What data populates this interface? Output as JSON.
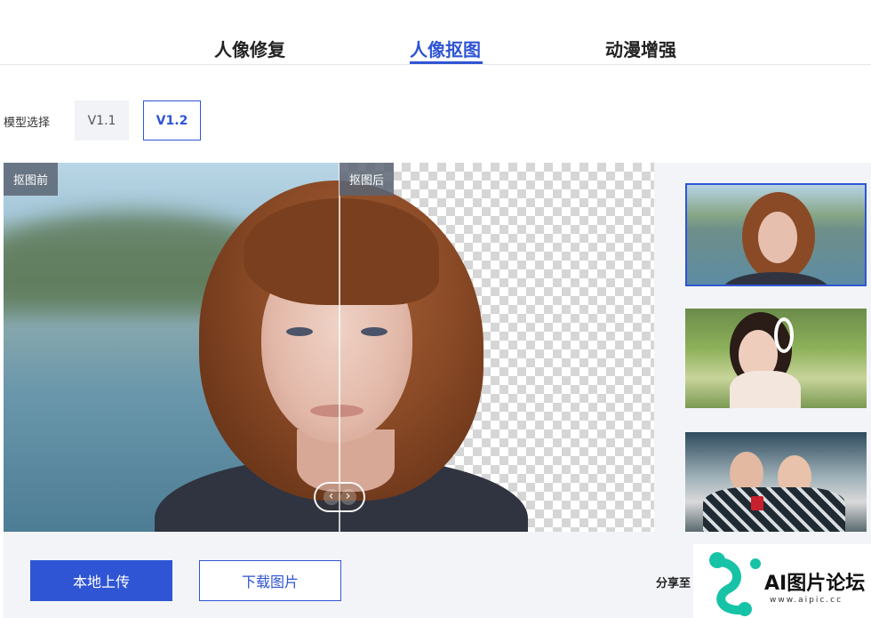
{
  "tabs": [
    {
      "label": "人像修复",
      "active": false
    },
    {
      "label": "人像抠图",
      "active": true
    },
    {
      "label": "动漫增强",
      "active": false
    }
  ],
  "model": {
    "label": "模型选择",
    "options": [
      {
        "label": "V1.1",
        "selected": false
      },
      {
        "label": "V1.2",
        "selected": true
      }
    ]
  },
  "compare": {
    "before_label": "抠图前",
    "after_label": "抠图后",
    "slider_icon": "chevron-left-right-icon"
  },
  "samples": [
    {
      "name": "sample-redhead-portrait",
      "selected": true
    },
    {
      "name": "sample-girl-headphones",
      "selected": false
    },
    {
      "name": "sample-couple-outdoors",
      "selected": false
    }
  ],
  "actions": {
    "upload_label": "本地上传",
    "download_label": "下载图片",
    "share_label": "分享至"
  },
  "watermark": {
    "title": "AI图片论坛",
    "url": "www.aipic.cc"
  },
  "colors": {
    "accent": "#2f55d4",
    "panel_bg": "#f2f4f8",
    "watermark_teal": "#17c3a6"
  }
}
